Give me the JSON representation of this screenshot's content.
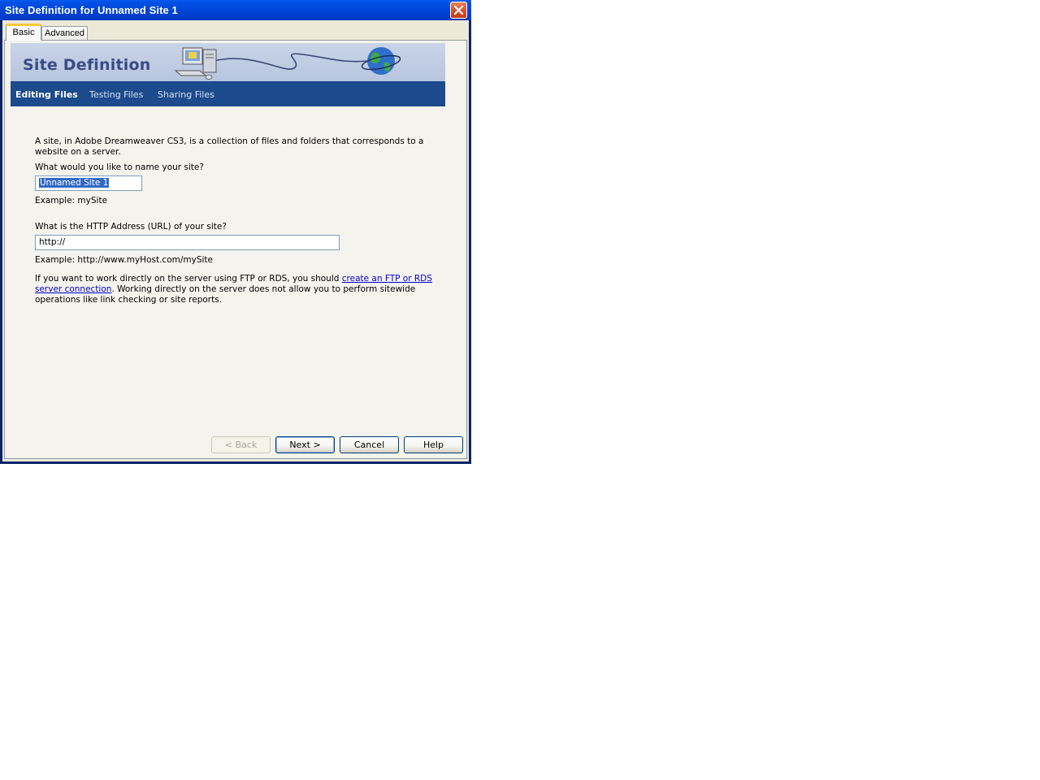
{
  "window": {
    "title": "Site Definition for Unnamed Site 1"
  },
  "tabs": [
    {
      "label": "Basic",
      "active": true
    },
    {
      "label": "Advanced",
      "active": false
    }
  ],
  "banner": {
    "title": "Site Definition",
    "icons": [
      "computer-icon",
      "cable-icon",
      "globe-icon"
    ]
  },
  "subnav": {
    "items": [
      {
        "label": "Editing Files",
        "active": true
      },
      {
        "label": "Testing Files",
        "active": false
      },
      {
        "label": "Sharing Files",
        "active": false
      }
    ]
  },
  "content": {
    "intro_line1": "A site, in Adobe Dreamweaver CS3, is a collection of files and folders that corresponds to a",
    "intro_line2": "website on a server.",
    "name_question": "What would you like to name your site?",
    "name_value": "Unnamed Site 1",
    "name_example": "Example: mySite",
    "url_question": "What is the HTTP Address (URL) of your site?",
    "url_value": "http://",
    "url_example": "Example: http://www.myHost.com/mySite",
    "ftp_text_before": "If you want to work directly on the server using FTP or RDS, you should ",
    "ftp_link_line1": "create an FTP or RDS",
    "ftp_link_line2": "server connection",
    "ftp_text_after_line2": ".  Working directly on the server does not allow you to perform sitewide",
    "ftp_text_line3": "operations like link checking or site reports."
  },
  "buttons": {
    "back": "< Back",
    "next": "Next >",
    "cancel": "Cancel",
    "help": "Help"
  },
  "colors": {
    "titlebar": "#0045d8",
    "subnav": "#1c4a8c",
    "banner_title": "#3a4c86",
    "selection": "#316ac5",
    "link": "#0000cc"
  }
}
